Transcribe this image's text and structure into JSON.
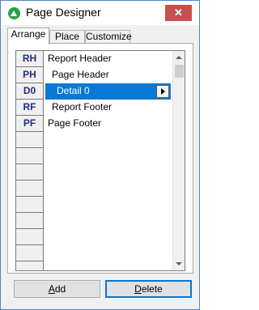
{
  "window": {
    "title": "Page Designer",
    "close_label": "✕"
  },
  "tabs": [
    {
      "label": "Arrange",
      "active": true
    },
    {
      "label": "Place",
      "active": false
    },
    {
      "label": "Customize",
      "active": false
    }
  ],
  "sections": [
    {
      "code": "RH",
      "name": "Report Header",
      "selected": false
    },
    {
      "code": "PH",
      "name": "Page Header",
      "selected": false
    },
    {
      "code": "D0",
      "name": "Detail 0",
      "selected": true
    },
    {
      "code": "RF",
      "name": "Report Footer",
      "selected": false
    },
    {
      "code": "PF",
      "name": "Page Footer",
      "selected": false
    }
  ],
  "empty_rows": 9,
  "buttons": {
    "add": {
      "mnemonic": "A",
      "rest": "dd"
    },
    "delete": {
      "mnemonic": "D",
      "rest": "elete"
    }
  },
  "colors": {
    "selection": "#0a78d7",
    "code_text": "#1f2f7a",
    "close": "#c74f4f"
  }
}
